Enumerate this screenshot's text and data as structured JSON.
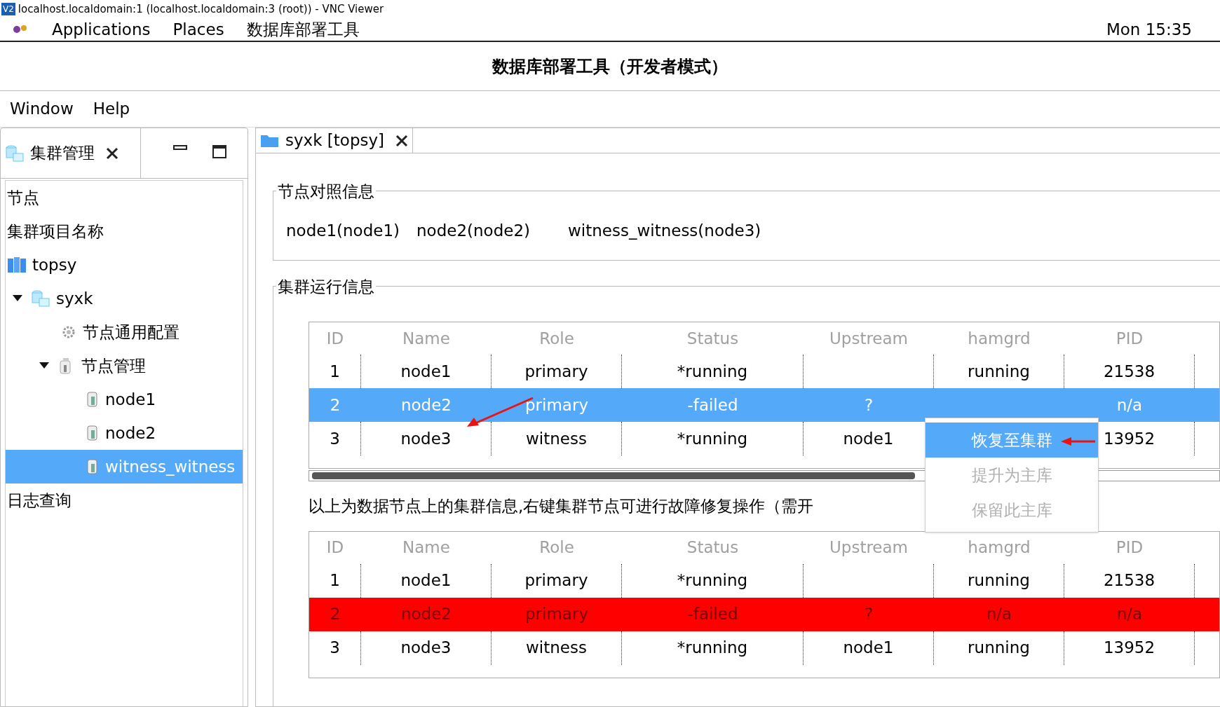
{
  "vnc": {
    "icon_label": "V2",
    "title": "localhost.localdomain:1 (localhost.localdomain:3 (root)) - VNC Viewer"
  },
  "top_bar": {
    "items": [
      "Applications",
      "Places",
      "数据库部署工具"
    ],
    "clock": "Mon 15:35"
  },
  "window_title": "数据库部署工具（开发者模式）",
  "menu": [
    "Window",
    "Help"
  ],
  "left_panel": {
    "tab": {
      "label": "集群管理"
    },
    "tree": [
      {
        "label": "节点",
        "kind": "text"
      },
      {
        "label": "集群项目名称",
        "kind": "text"
      },
      {
        "label": "topsy",
        "kind": "cluster"
      },
      {
        "label": "syxk",
        "kind": "db",
        "expanded": true,
        "children": [
          {
            "label": "节点通用配置",
            "kind": "gear"
          },
          {
            "label": "节点管理",
            "kind": "nodes",
            "expanded": true,
            "children": [
              {
                "label": "node1",
                "kind": "node",
                "selected": false
              },
              {
                "label": "node2",
                "kind": "node",
                "selected": false
              },
              {
                "label": "witness_witness",
                "kind": "node",
                "selected": true
              }
            ]
          }
        ]
      },
      {
        "label": "日志查询",
        "kind": "text"
      }
    ]
  },
  "editor_tab": {
    "label": "syxk [topsy]"
  },
  "node_mapping": {
    "title": "节点对照信息",
    "entries": [
      "node1(node1)",
      "node2(node2)",
      "witness_witness(node3)"
    ]
  },
  "cluster_info": {
    "title": "集群运行信息",
    "tables": [
      {
        "columns": [
          "ID",
          "Name",
          "Role",
          "Status",
          "Upstream",
          "hamgrd",
          "PID"
        ],
        "rows": [
          {
            "cells": [
              "1",
              "node1",
              "primary",
              "*running",
              null,
              "running",
              "21538"
            ],
            "selected": false,
            "error": false
          },
          {
            "cells": [
              "2",
              "node2",
              "primary",
              "-failed",
              "?",
              null,
              "n/a"
            ],
            "selected": true,
            "error": false
          },
          {
            "cells": [
              "3",
              "node3",
              "witness",
              "*running",
              "node1",
              null,
              "13952"
            ],
            "selected": false,
            "error": false
          }
        ]
      },
      {
        "columns": [
          "ID",
          "Name",
          "Role",
          "Status",
          "Upstream",
          "hamgrd",
          "PID"
        ],
        "rows": [
          {
            "cells": [
              "1",
              "node1",
              "primary",
              "*running",
              null,
              "running",
              "21538"
            ],
            "selected": false,
            "error": false
          },
          {
            "cells": [
              "2",
              "node2",
              "primary",
              "-failed",
              "?",
              "n/a",
              "n/a"
            ],
            "selected": false,
            "error": true
          },
          {
            "cells": [
              "3",
              "node3",
              "witness",
              "*running",
              "node1",
              "running",
              "13952"
            ],
            "selected": false,
            "error": false
          }
        ]
      }
    ],
    "note": "以上为数据节点上的集群信息,右键集群节点可进行故障修复操作（需开"
  },
  "context_menu": {
    "items": [
      {
        "label": "恢复至集群",
        "selected": true,
        "disabled": false
      },
      {
        "label": "提升为主库",
        "selected": false,
        "disabled": true
      },
      {
        "label": "保留此主库",
        "selected": false,
        "disabled": true
      }
    ]
  }
}
